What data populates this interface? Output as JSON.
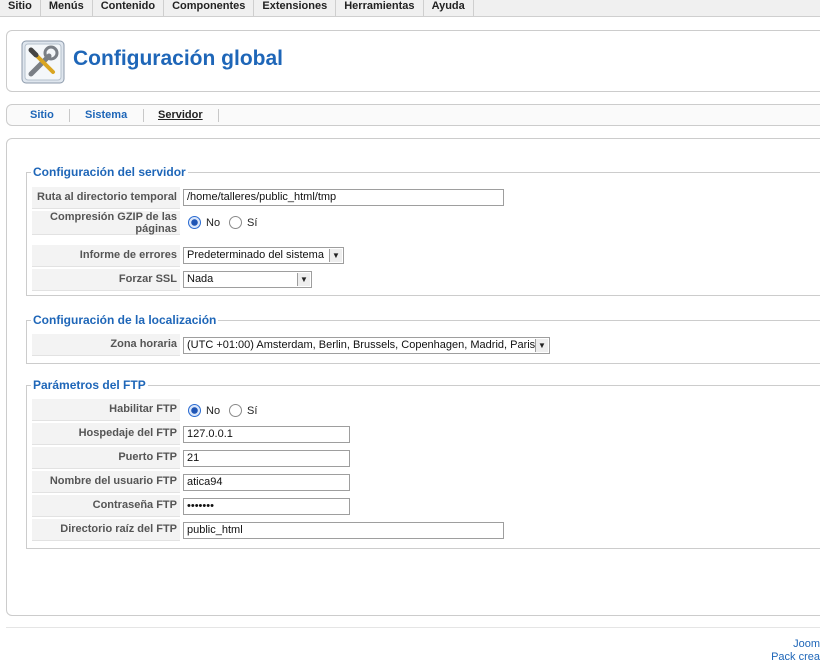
{
  "menubar": {
    "items": [
      "Sitio",
      "Menús",
      "Contenido",
      "Componentes",
      "Extensiones",
      "Herramientas",
      "Ayuda"
    ]
  },
  "page": {
    "title": "Configuración global",
    "icon": "config-tools-icon"
  },
  "tabs": [
    {
      "label": "Sitio",
      "active": false
    },
    {
      "label": "Sistema",
      "active": false
    },
    {
      "label": "Servidor",
      "active": true
    }
  ],
  "server": {
    "legend": "Configuración del servidor",
    "temp_dir_label": "Ruta al directorio temporal",
    "temp_dir_value": "/home/talleres/public_html/tmp",
    "gzip_label": "Compresión GZIP de las páginas",
    "gzip_no": "No",
    "gzip_yes": "Sí",
    "gzip_selected": "No",
    "errors_label": "Informe de errores",
    "errors_value": "Predeterminado del sistema",
    "ssl_label": "Forzar SSL",
    "ssl_value": "Nada"
  },
  "locale": {
    "legend": "Configuración de la localización",
    "tz_label": "Zona horaria",
    "tz_value": "(UTC +01:00) Amsterdam, Berlin, Brussels, Copenhagen, Madrid, Paris"
  },
  "ftp": {
    "legend": "Parámetros del FTP",
    "enable_label": "Habilitar FTP",
    "enable_no": "No",
    "enable_yes": "Sí",
    "enable_selected": "No",
    "host_label": "Hospedaje del FTP",
    "host_value": "127.0.0.1",
    "port_label": "Puerto FTP",
    "port_value": "21",
    "user_label": "Nombre del usuario FTP",
    "user_value": "atica94",
    "pass_label": "Contraseña FTP",
    "pass_value": "•••••••",
    "root_label": "Directorio raíz del FTP",
    "root_value": "public_html"
  },
  "footer": {
    "line1": "Joom",
    "line2": "Pack crea"
  },
  "colors": {
    "accent": "#1e66b8",
    "label_bg": "#f3f3f3"
  }
}
